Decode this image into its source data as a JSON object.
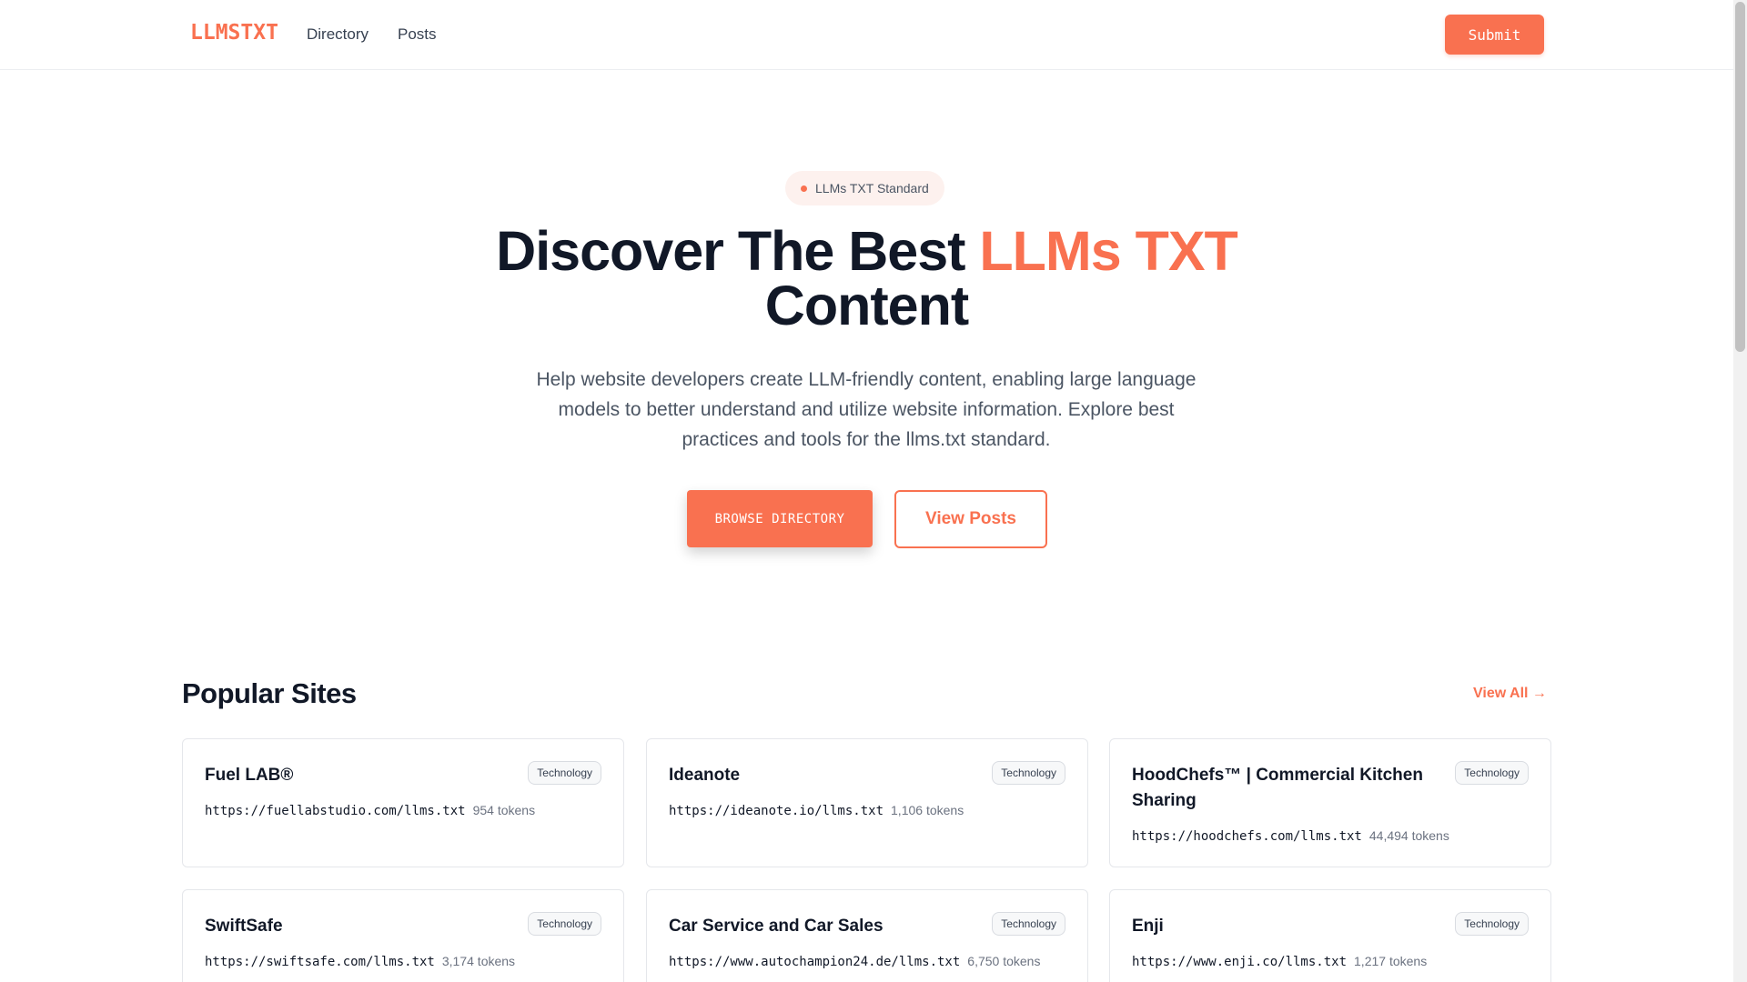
{
  "header": {
    "logo": "LLMSTXT",
    "nav": [
      "Directory",
      "Posts"
    ],
    "submit_label": "Submit"
  },
  "hero": {
    "badge": "LLMs TXT Standard",
    "title_part1": "Discover The Best ",
    "title_accent": "LLMs TXT",
    "title_part2": "Content",
    "description": "Help website developers create LLM-friendly content, enabling large language models to better understand and utilize website information. Explore best practices and tools for the llms.txt standard.",
    "browse_label": "BROWSE DIRECTORY",
    "posts_label": "View Posts"
  },
  "popular": {
    "title": "Popular Sites",
    "view_all": "View All →",
    "cards": [
      {
        "title": "Fuel LAB®",
        "tag": "Technology",
        "url": "https://fuellabstudio.com/llms.txt",
        "tokens": "954 tokens"
      },
      {
        "title": "Ideanote",
        "tag": "Technology",
        "url": "https://ideanote.io/llms.txt",
        "tokens": "1,106 tokens"
      },
      {
        "title": "HoodChefs™ | Commercial Kitchen Sharing",
        "tag": "Technology",
        "url": "https://hoodchefs.com/llms.txt",
        "tokens": "44,494 tokens"
      },
      {
        "title": "SwiftSafe",
        "tag": "Technology",
        "url": "https://swiftsafe.com/llms.txt",
        "tokens": "3,174 tokens"
      },
      {
        "title": "Car Service and Car Sales",
        "tag": "Technology",
        "url": "https://www.autochampion24.de/llms.txt",
        "tokens": "6,750 tokens"
      },
      {
        "title": "Enji",
        "tag": "Technology",
        "url": "https://www.enji.co/llms.txt",
        "tokens": "1,217 tokens"
      }
    ]
  },
  "colors": {
    "accent": "#f97150",
    "text": "#111827",
    "muted": "#6b7280"
  }
}
